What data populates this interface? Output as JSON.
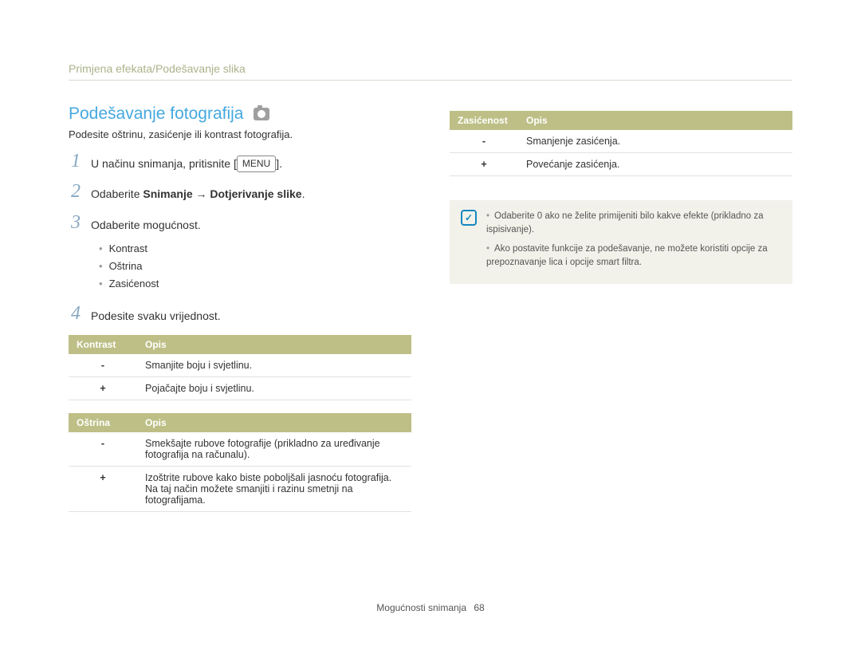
{
  "breadcrumb": "Primjena efekata/Podešavanje slika",
  "title": "Podešavanje fotografija",
  "subtitle": "Podesite oštrinu, zasićenje ili kontrast fotografija.",
  "steps": {
    "s1_a": "U načinu snimanja, pritisnite [",
    "s1_menu": "MENU",
    "s1_b": "].",
    "s2_a": "Odaberite ",
    "s2_bold": "Snimanje → Dotjerivanje slike",
    "s2_b": ".",
    "s3": "Odaberite mogućnost.",
    "s4": "Podesite svaku vrijednost."
  },
  "bullets": {
    "b1": "Kontrast",
    "b2": "Oštrina",
    "b3": "Zasićenost"
  },
  "table_kontrast": {
    "h1": "Kontrast",
    "h2": "Opis",
    "r1s": "-",
    "r1d": "Smanjite boju i svjetlinu.",
    "r2s": "+",
    "r2d": "Pojačajte boju i svjetlinu."
  },
  "table_ostrina": {
    "h1": "Oštrina",
    "h2": "Opis",
    "r1s": "-",
    "r1d": "Smekšajte rubove fotografije (prikladno za uređivanje fotografija na računalu).",
    "r2s": "+",
    "r2d": "Izoštrite rubove kako biste poboljšali jasnoću fotografija. Na taj način možete smanjiti i razinu smetnji na fotografijama."
  },
  "table_zasicenost": {
    "h1": "Zasićenost",
    "h2": "Opis",
    "r1s": "-",
    "r1d": "Smanjenje zasićenja.",
    "r2s": "+",
    "r2d": "Povećanje zasićenja."
  },
  "notes": {
    "n1": "Odaberite 0 ako ne želite primijeniti bilo kakve efekte (prikladno za ispisivanje).",
    "n2": "Ako postavite funkcije za podešavanje, ne možete koristiti opcije za prepoznavanje lica i opcije smart filtra."
  },
  "footer": {
    "section": "Mogućnosti snimanja",
    "page": "68"
  }
}
